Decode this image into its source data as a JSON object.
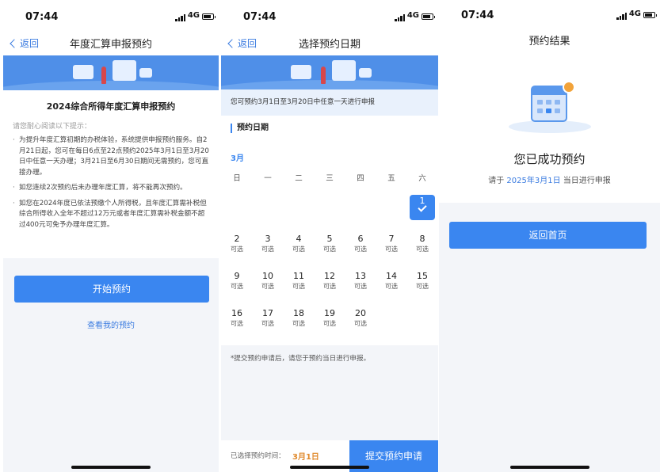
{
  "status": {
    "time": "07:44",
    "network": "4G"
  },
  "screen1": {
    "back": "返回",
    "title": "年度汇算申报预约",
    "heading": "2024综合所得年度汇算申报预约",
    "hint": "请您耐心阅读以下提示：",
    "paragraphs": [
      "为提升年度汇算初期的办税体验，系统提供申报预约服务。自2月21日起，您可在每日6点至22点预约2025年3月1日至3月20日中任意一天办理；3月21日至6月30日期间无需预约，您可直接办理。",
      "如您连续2次预约后未办理年度汇算，将不能再次预约。",
      "如您在2024年度已依法预缴个人所得税，且年度汇算需补税但综合所得收入全年不超过12万元或者年度汇算需补税金额不超过400元可免予办理年度汇算。"
    ],
    "start_button": "开始预约",
    "my_link": "查看我的预约"
  },
  "screen2": {
    "back": "返回",
    "title": "选择预约日期",
    "notice": "您可预约3月1日至3月20日中任意一天进行申报",
    "section_title": "预约日期",
    "month": "3月",
    "weekdays": [
      "日",
      "一",
      "二",
      "三",
      "四",
      "五",
      "六"
    ],
    "days": [
      {
        "n": "1",
        "s": ""
      },
      {
        "n": "2",
        "s": "可选"
      },
      {
        "n": "3",
        "s": "可选"
      },
      {
        "n": "4",
        "s": "可选"
      },
      {
        "n": "5",
        "s": "可选"
      },
      {
        "n": "6",
        "s": "可选"
      },
      {
        "n": "7",
        "s": "可选"
      },
      {
        "n": "8",
        "s": "可选"
      },
      {
        "n": "9",
        "s": "可选"
      },
      {
        "n": "10",
        "s": "可选"
      },
      {
        "n": "11",
        "s": "可选"
      },
      {
        "n": "12",
        "s": "可选"
      },
      {
        "n": "13",
        "s": "可选"
      },
      {
        "n": "14",
        "s": "可选"
      },
      {
        "n": "15",
        "s": "可选"
      },
      {
        "n": "16",
        "s": "可选"
      },
      {
        "n": "17",
        "s": "可选"
      },
      {
        "n": "18",
        "s": "可选"
      },
      {
        "n": "19",
        "s": "可选"
      },
      {
        "n": "20",
        "s": "可选"
      }
    ],
    "selected_day": "1",
    "footnote": "*提交预约申请后，请您于预约当日进行申报。",
    "selected_label": "已选择预约时间：",
    "selected_value": "3月1日",
    "submit_button": "提交预约申请"
  },
  "screen3": {
    "title": "预约结果",
    "success": "您已成功预约",
    "sub_prefix": "请于",
    "sub_date": "2025年3月1日",
    "sub_suffix": "当日进行申报",
    "home_button": "返回首页"
  },
  "colors": {
    "accent": "#3a86f0",
    "link": "#3a7be0",
    "highlight": "#e0892b",
    "banner": "#4f8fe8"
  }
}
